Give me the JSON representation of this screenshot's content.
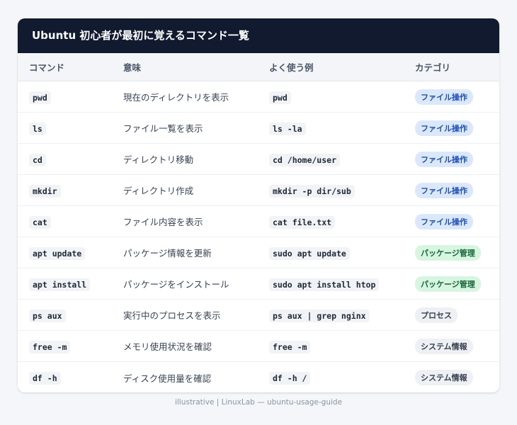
{
  "title": "Ubuntu 初心者が最初に覚えるコマンド一覧",
  "columns": [
    "コマンド",
    "意味",
    "よく使う例",
    "カテゴリ"
  ],
  "rows": [
    {
      "cmd": "pwd",
      "desc": "現在のディレクトリを表示",
      "example": "pwd",
      "category": "ファイル操作",
      "cat_type": "file"
    },
    {
      "cmd": "ls",
      "desc": "ファイル一覧を表示",
      "example": "ls -la",
      "category": "ファイル操作",
      "cat_type": "file"
    },
    {
      "cmd": "cd",
      "desc": "ディレクトリ移動",
      "example": "cd /home/user",
      "category": "ファイル操作",
      "cat_type": "file"
    },
    {
      "cmd": "mkdir",
      "desc": "ディレクトリ作成",
      "example": "mkdir -p dir/sub",
      "category": "ファイル操作",
      "cat_type": "file"
    },
    {
      "cmd": "cat",
      "desc": "ファイル内容を表示",
      "example": "cat file.txt",
      "category": "ファイル操作",
      "cat_type": "file"
    },
    {
      "cmd": "apt update",
      "desc": "パッケージ情報を更新",
      "example": "sudo apt update",
      "category": "パッケージ管理",
      "cat_type": "pkg"
    },
    {
      "cmd": "apt install",
      "desc": "パッケージをインストール",
      "example": "sudo apt install htop",
      "category": "パッケージ管理",
      "cat_type": "pkg"
    },
    {
      "cmd": "ps aux",
      "desc": "実行中のプロセスを表示",
      "example": "ps aux | grep nginx",
      "category": "プロセス",
      "cat_type": "gray"
    },
    {
      "cmd": "free -m",
      "desc": "メモリ使用状況を確認",
      "example": "free -m",
      "category": "システム情報",
      "cat_type": "gray"
    },
    {
      "cmd": "df -h",
      "desc": "ディスク使用量を確認",
      "example": "df -h /",
      "category": "システム情報",
      "cat_type": "gray"
    }
  ],
  "colors": {
    "header_bg": "#111a2e",
    "file_badge_bg": "#dbe8fc",
    "file_badge_text": "#1e4fae",
    "pkg_badge_bg": "#d7f5e1",
    "pkg_badge_text": "#17663a",
    "gray_badge_bg": "#eef0f3"
  },
  "footer": "illustrative | LinuxLab — ubuntu-usage-guide"
}
